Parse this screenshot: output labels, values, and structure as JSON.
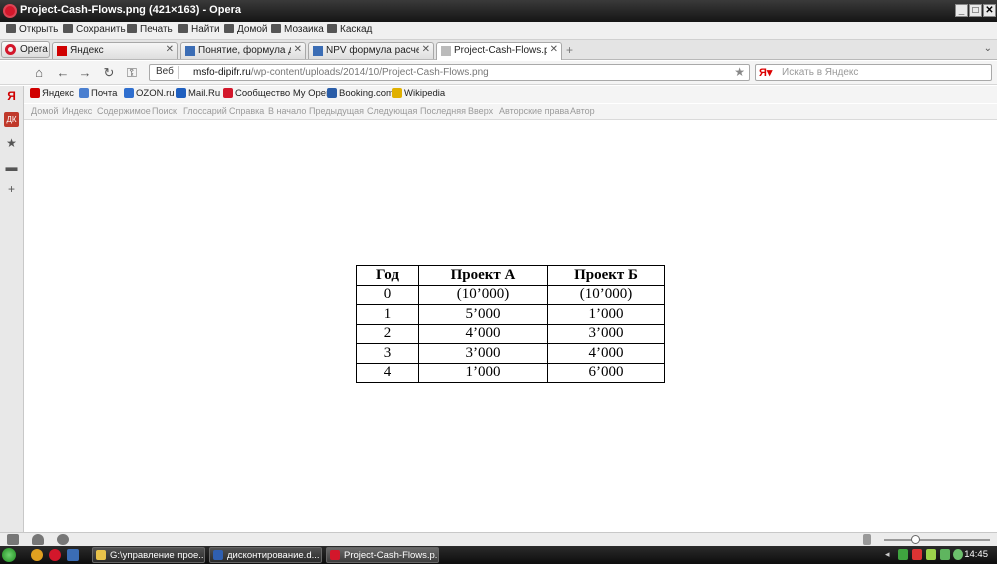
{
  "window": {
    "title": "Project-Cash-Flows.png (421×163) - Opera",
    "controls": [
      "_",
      "□",
      "✕"
    ]
  },
  "menu": [
    "Открыть",
    "Сохранить",
    "Печать",
    "Найти",
    "Домой",
    "Мозаика",
    "Каскад"
  ],
  "opera_button": "Opera",
  "tabs": [
    {
      "label": "Яндекс",
      "favicon_color": "#d00000",
      "active": false
    },
    {
      "label": "Понятие, формула дис...",
      "favicon_color": "#3b6db5",
      "active": false
    },
    {
      "label": "NPV формула расчета п...",
      "favicon_color": "#3b6db5",
      "active": false
    },
    {
      "label": "Project-Cash-Flows.png ...",
      "favicon_color": "#bbbbbb",
      "active": true
    }
  ],
  "address": {
    "web_label": "Веб",
    "url_domain": "msfo-dipifr.ru",
    "url_path": "/wp-content/uploads/2014/10/Project-Cash-Flows.png",
    "search_placeholder": "Искать в Яндекс"
  },
  "bookmarks": [
    {
      "label": "Яндекс",
      "color": "#d00000"
    },
    {
      "label": "Почта",
      "color": "#4a7fd0"
    },
    {
      "label": "OZON.ru",
      "color": "#2f6fcf"
    },
    {
      "label": "Mail.Ru",
      "color": "#1f5fbf"
    },
    {
      "label": "Сообщество My Opera",
      "color": "#d3172b"
    },
    {
      "label": "Booking.com",
      "color": "#2a5da8"
    },
    {
      "label": "Wikipedia",
      "color": "#e0b000"
    }
  ],
  "nav_links": [
    "Домой",
    "Индекс",
    "Содержимое",
    "Поиск",
    "Глоссарий",
    "Справка",
    "В начало",
    "Предыдущая",
    "Следующая",
    "Последняя",
    "Вверх",
    "Авторские права",
    "Автор"
  ],
  "image_table": {
    "headers": [
      "Год",
      "Проект А",
      "Проект Б"
    ],
    "rows": [
      [
        "0",
        "(10’000)",
        "(10’000)"
      ],
      [
        "1",
        "5’000",
        "1’000"
      ],
      [
        "2",
        "4’000",
        "3’000"
      ],
      [
        "3",
        "3’000",
        "4’000"
      ],
      [
        "4",
        "1’000",
        "6’000"
      ]
    ]
  },
  "taskbar": {
    "tasks": [
      {
        "label": "G:\\управление прое...",
        "icon_color": "#e8c24a",
        "active": false
      },
      {
        "label": "дисконтирование.d...",
        "icon_color": "#2f5fb0",
        "active": false
      },
      {
        "label": "Project-Cash-Flows.p...",
        "icon_color": "#d3172b",
        "active": true
      }
    ],
    "clock": "14:45"
  }
}
